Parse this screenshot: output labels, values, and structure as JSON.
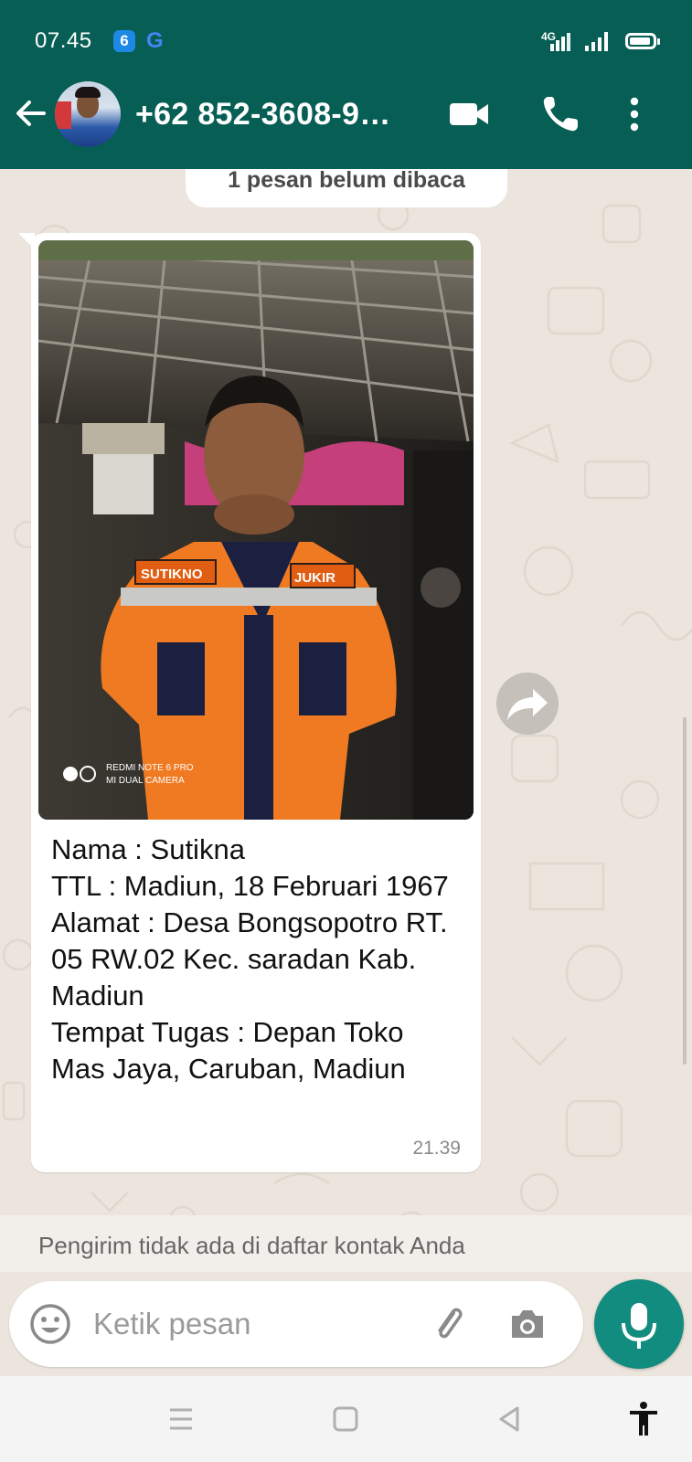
{
  "status_bar": {
    "time": "07.45",
    "network": "4G",
    "icons": [
      "app-notification-icon",
      "google-icon",
      "signal-icon",
      "wifi-signal-icon",
      "battery-icon"
    ],
    "battery_level": 0.85
  },
  "header": {
    "contact": "+62 852-3608-9…",
    "icons": [
      "back-arrow-icon",
      "avatar",
      "video-call-icon",
      "voice-call-icon",
      "more-options-icon"
    ]
  },
  "chat": {
    "unread_label": "1 pesan belum dibaca",
    "message": {
      "photo_watermark_line1": "REDMI NOTE 6 PRO",
      "photo_watermark_line2": "MI DUAL CAMERA",
      "photo_name_patch_left": "SUTIKNO",
      "photo_name_patch_right": "JUKIR",
      "caption_lines": [
        "Nama : Sutikna",
        "TTL : Madiun, 18 Februari 1967",
        "Alamat : Desa Bongsopotro RT. 05 RW.02 Kec. saradan Kab. Madiun",
        "Tempat Tugas : Depan Toko Mas Jaya, Caruban, Madiun"
      ],
      "time": "21.39"
    },
    "forward_icon": "forward-icon",
    "notice": "Pengirim tidak ada di daftar kontak Anda"
  },
  "composer": {
    "placeholder": "Ketik pesan",
    "icons": [
      "emoji-icon",
      "attach-icon",
      "camera-icon",
      "mic-icon"
    ]
  },
  "nav": {
    "icons": [
      "recent-apps-icon",
      "home-icon",
      "back-icon",
      "accessibility-icon"
    ]
  },
  "colors": {
    "header_green": "#075e54",
    "accent_teal": "#128c7e",
    "chat_bg": "#ece5dd"
  }
}
